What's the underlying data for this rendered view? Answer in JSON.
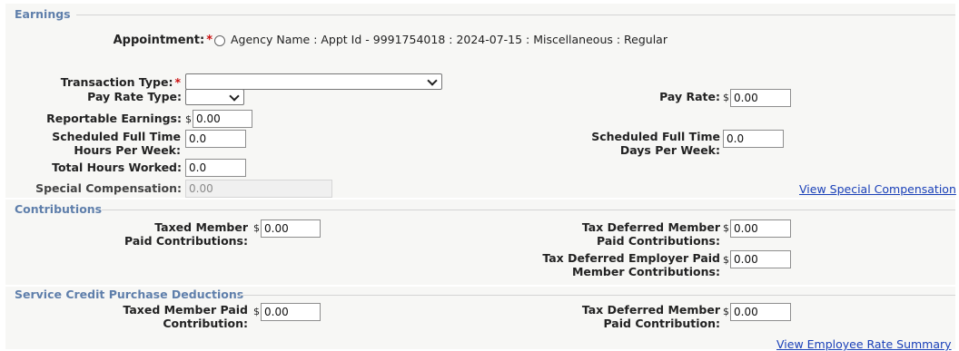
{
  "earnings": {
    "title": "Earnings",
    "appointment_label": "Appointment:",
    "appointment_value": "Agency Name : Appt Id - 9991754018 : 2024-07-15 : Miscellaneous : Regular",
    "transaction_type_label": "Transaction Type:",
    "transaction_type_value": "",
    "pay_rate_type_label": "Pay Rate Type:",
    "pay_rate_type_value": "",
    "pay_rate_label": "Pay Rate:",
    "pay_rate_value": "0.00",
    "reportable_earnings_label": "Reportable Earnings:",
    "reportable_earnings_value": "0.00",
    "sched_hours_label_1": "Scheduled Full Time",
    "sched_hours_label_2": "Hours Per Week:",
    "sched_hours_value": "0.0",
    "sched_days_label_1": "Scheduled Full Time",
    "sched_days_label_2": "Days Per Week:",
    "sched_days_value": "0.0",
    "total_hours_label": "Total Hours Worked:",
    "total_hours_value": "0.0",
    "special_comp_label": "Special Compensation:",
    "special_comp_value": "0.00",
    "view_special_comp_link": "View Special Compensation"
  },
  "contributions": {
    "title": "Contributions",
    "taxed_member_label_1": "Taxed Member",
    "taxed_member_label_2": "Paid Contributions:",
    "taxed_member_value": "0.00",
    "tax_deferred_member_label_1": "Tax Deferred Member",
    "tax_deferred_member_label_2": "Paid Contributions:",
    "tax_deferred_member_value": "0.00",
    "tax_deferred_employer_label_1": "Tax Deferred Employer Paid",
    "tax_deferred_employer_label_2": "Member Contributions:",
    "tax_deferred_employer_value": "0.00"
  },
  "service_credit": {
    "title": "Service Credit Purchase Deductions",
    "taxed_member_label_1": "Taxed Member Paid",
    "taxed_member_label_2": "Contribution:",
    "taxed_member_value": "0.00",
    "tax_deferred_member_label_1": "Tax Deferred Member",
    "tax_deferred_member_label_2": "Paid Contribution:",
    "tax_deferred_member_value": "0.00"
  },
  "currency_symbol": "$",
  "required_mark": "*",
  "view_rate_summary_link": "View Employee Rate Summary"
}
